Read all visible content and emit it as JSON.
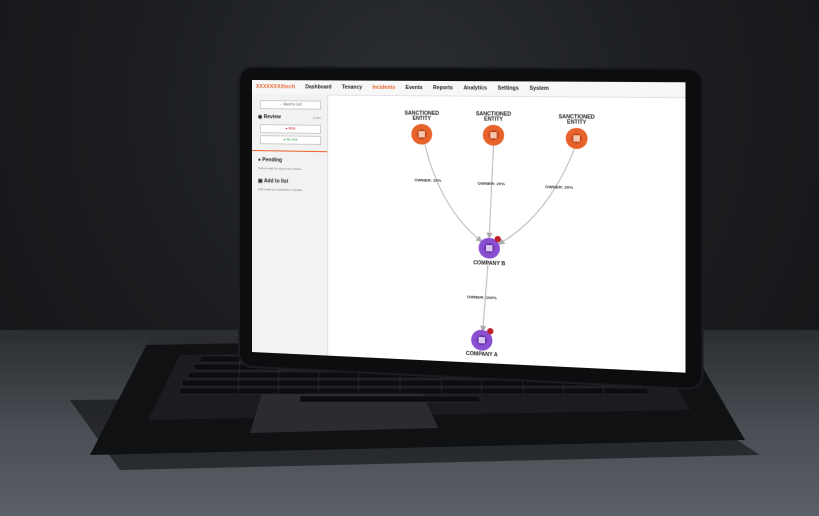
{
  "nav": {
    "brand": "XXXXXXXXtech",
    "items": [
      "Dashboard",
      "Tenancy",
      "Incidents",
      "Events",
      "Reports",
      "Analytics",
      "Settings",
      "System"
    ],
    "active": "Incidents"
  },
  "sidebar": {
    "back_label": "← Back to List",
    "review_title": "Review",
    "review_meta": "1 item",
    "risk_label": "Risk",
    "no_risk_label": "No risk",
    "pending_title": "Pending",
    "pending_sub": "Submit task for document review",
    "add_title": "Add to list",
    "add_sub": "Add entity to a watchlist or profile"
  },
  "graph": {
    "nodes": {
      "sanctioned_1": "SANCTIONED ENTITY",
      "sanctioned_2": "SANCTIONED ENTITY",
      "sanctioned_3": "SANCTIONED ENTITY",
      "company_b": "COMPANY B",
      "company_a": "COMPANY A"
    },
    "edges": {
      "e1": "OWNER: 10%",
      "e2": "OWNER: 20%",
      "e3": "OWNER: 20%",
      "e4": "OWNER: 100%"
    },
    "colors": {
      "sanctioned": "#e8632b",
      "company": "#8a4fd1",
      "alert": "#c0202a"
    }
  }
}
